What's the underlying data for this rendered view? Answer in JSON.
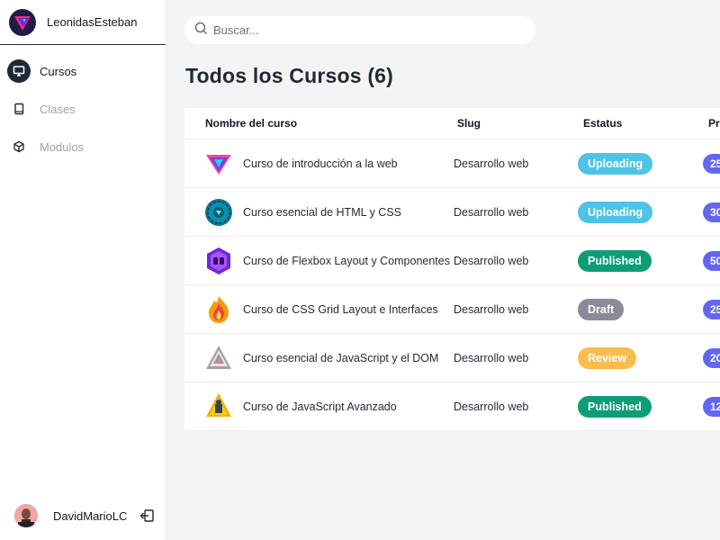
{
  "app": {
    "brand_name": "LeonidasEsteban"
  },
  "sidebar": {
    "items": [
      {
        "label": "Cursos",
        "icon": "monitor-icon",
        "active": true
      },
      {
        "label": "Clases",
        "icon": "book-icon",
        "active": false
      },
      {
        "label": "Modulos",
        "icon": "cube-icon",
        "active": false
      }
    ]
  },
  "user": {
    "name": "DavidMarioLC",
    "logout_icon": "logout-icon"
  },
  "search": {
    "placeholder": "Buscar...",
    "value": ""
  },
  "main": {
    "title": "Todos los Cursos (6)"
  },
  "table": {
    "headers": {
      "name": "Nombre del curso",
      "slug": "Slug",
      "status": "Estatus",
      "price": "Pr"
    },
    "rows": [
      {
        "name": "Curso de introducción a la web",
        "slug": "Desarrollo web",
        "status": "Uploading",
        "price": "25",
        "icon": "web-intro-triangle-icon"
      },
      {
        "name": "Curso esencial de HTML y CSS",
        "slug": "Desarrollo web",
        "status": "Uploading",
        "price": "30",
        "icon": "html-css-gear-badge-icon"
      },
      {
        "name": "Curso de Flexbox Layout y Componentes",
        "slug": "Desarrollo web",
        "status": "Published",
        "price": "50",
        "icon": "flexbox-badge-icon"
      },
      {
        "name": "Curso de CSS Grid Layout e Interfaces",
        "slug": "Desarrollo web",
        "status": "Draft",
        "price": "25",
        "icon": "css-grid-flame-icon"
      },
      {
        "name": "Curso esencial de JavaScript y el DOM",
        "slug": "Desarrollo web",
        "status": "Review",
        "price": "20",
        "icon": "javascript-dom-triangle-icon"
      },
      {
        "name": "Curso de JavaScript Avanzado",
        "slug": "Desarrollo web",
        "status": "Published",
        "price": "12",
        "icon": "javascript-advanced-badge-icon"
      }
    ]
  },
  "colors": {
    "status_uploading": "#4fc3e6",
    "status_published": "#0f9d77",
    "status_draft": "#8b8a99",
    "status_review": "#fbbd4a",
    "price_pill": "#6366f1",
    "active_nav": "#1f2937"
  }
}
